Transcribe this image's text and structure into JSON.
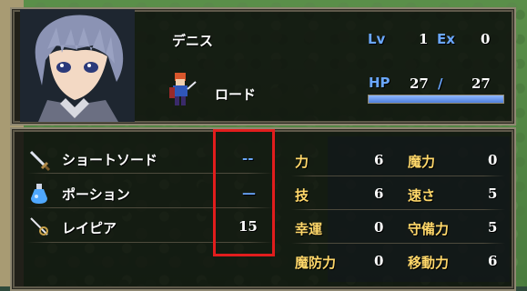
{
  "unit": {
    "name": "デニス",
    "class": "ロード",
    "level_label": "Lv",
    "level": "1",
    "exp_label": "Ex",
    "exp": "0",
    "hp_label": "HP",
    "hp_current": "27",
    "hp_separator": "/",
    "hp_max": "27",
    "hp_fraction": 1.0
  },
  "items": [
    {
      "icon": "sword-icon",
      "name": "ショートソード",
      "uses": "--"
    },
    {
      "icon": "potion-icon",
      "name": "ポーション",
      "uses": "—"
    },
    {
      "icon": "rapier-icon",
      "name": "レイピア",
      "uses": "15"
    }
  ],
  "stats": [
    {
      "label": "力",
      "value": "6"
    },
    {
      "label": "魔力",
      "value": "0"
    },
    {
      "label": "技",
      "value": "6"
    },
    {
      "label": "速さ",
      "value": "5"
    },
    {
      "label": "幸運",
      "value": "0"
    },
    {
      "label": "守備力",
      "value": "5"
    },
    {
      "label": "魔防力",
      "value": "0"
    },
    {
      "label": "移動力",
      "value": "6"
    }
  ],
  "colors": {
    "label_blue": "#6aa7ff",
    "stat_gold": "#ffd86a",
    "highlight_red": "#e11d1d"
  }
}
